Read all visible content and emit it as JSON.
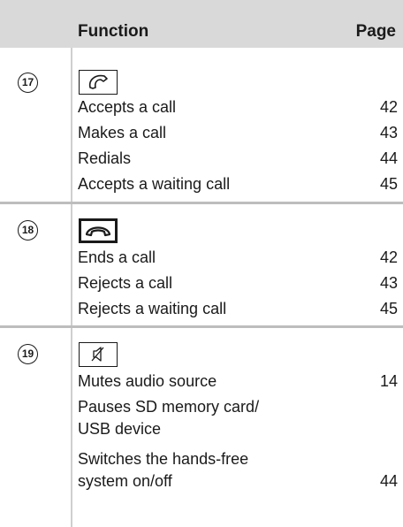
{
  "header": {
    "function_label": "Function",
    "page_label": "Page"
  },
  "sections": [
    {
      "number": "17",
      "key_icon": "phone-accept-icon",
      "rows": [
        {
          "text": "Accepts a call",
          "page": "42"
        },
        {
          "text": "Makes a call",
          "page": "43"
        },
        {
          "text": "Redials",
          "page": "44"
        },
        {
          "text": "Accepts a waiting call",
          "page": "45"
        }
      ]
    },
    {
      "number": "18",
      "key_icon": "phone-hangup-icon",
      "rows": [
        {
          "text": "Ends a call",
          "page": "42"
        },
        {
          "text": "Rejects a call",
          "page": "43"
        },
        {
          "text": "Rejects a waiting call",
          "page": "45"
        }
      ]
    },
    {
      "number": "19",
      "key_icon": "mute-speaker-icon",
      "rows": [
        {
          "text": "Mutes audio source",
          "page": "14"
        },
        {
          "text": "Pauses SD memory card/",
          "page": ""
        },
        {
          "text": "USB device",
          "page": ""
        },
        {
          "text": "Switches the hands-free",
          "page": ""
        },
        {
          "text": "system on/off",
          "page": "44"
        }
      ]
    }
  ]
}
